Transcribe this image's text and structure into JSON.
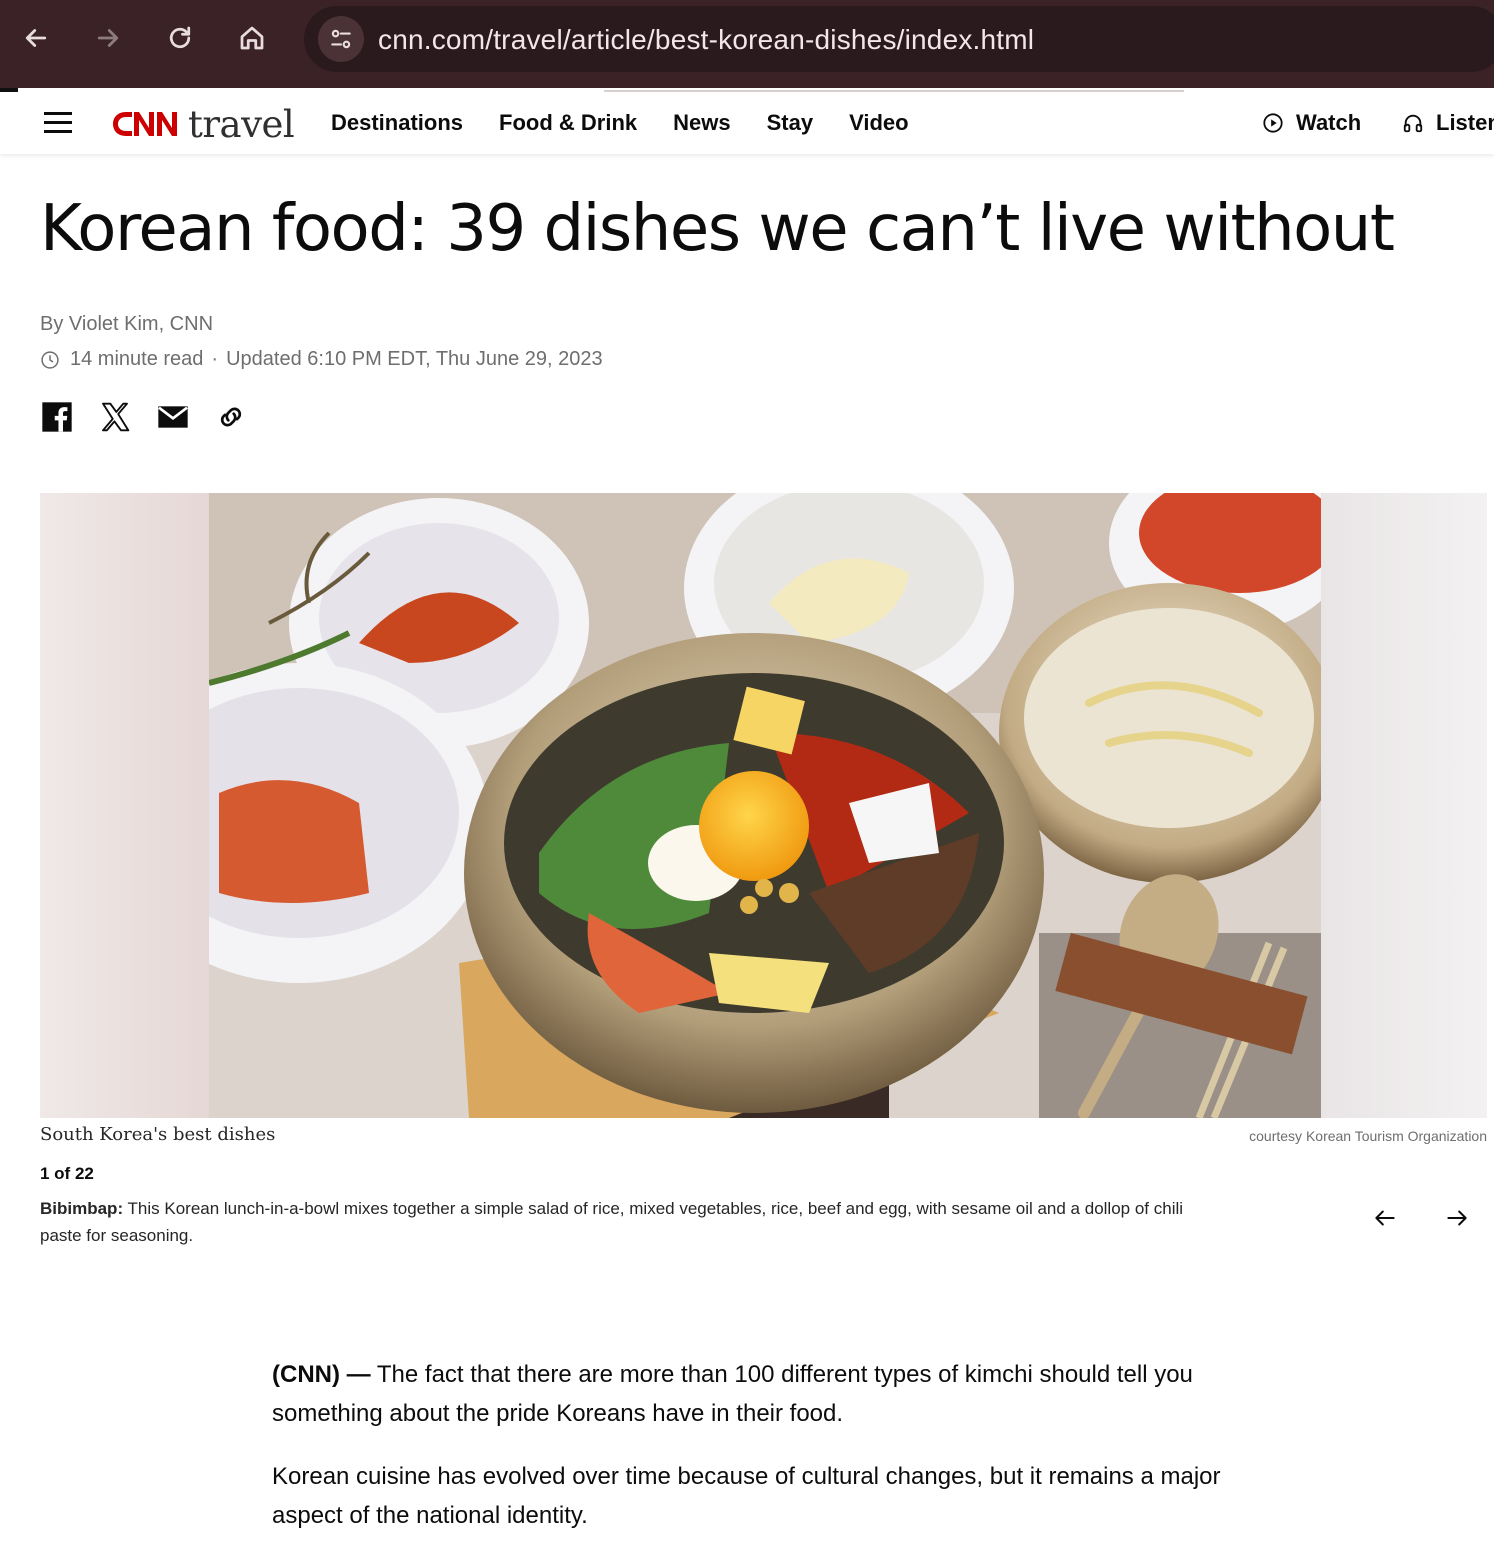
{
  "browser": {
    "url": "cnn.com/travel/article/best-korean-dishes/index.html"
  },
  "header": {
    "logo_brand": "CNN",
    "logo_section": "travel",
    "nav": [
      "Destinations",
      "Food & Drink",
      "News",
      "Stay",
      "Video"
    ],
    "watch_label": "Watch",
    "listen_label": "Listen"
  },
  "article": {
    "headline": "Korean food: 39 dishes we can’t live without",
    "byline": "By Violet Kim, CNN",
    "read_time": "14 minute read",
    "separator": "·",
    "updated": "Updated 6:10 PM EDT, Thu June 29, 2023"
  },
  "share": {
    "icons": [
      "facebook-icon",
      "x-icon",
      "email-icon",
      "link-icon"
    ]
  },
  "gallery": {
    "title": "South Korea's best dishes",
    "credit": "courtesy Korean Tourism Organization",
    "counter": "1 of 22",
    "caption_bold": "Bibimbap:",
    "caption_text": " This Korean lunch-in-a-bowl mixes together a simple salad of rice, mixed vegetables, rice, beef and egg, with sesame oil and a dollop of chili paste for seasoning."
  },
  "body": {
    "p1_lead": "(CNN) —",
    "p1_text": " The fact that there are more than 100 different types of kimchi should tell you something about the pride Koreans have in their food.",
    "p2_text": "Korean cuisine has evolved over time because of cultural changes, but it remains a major aspect of the national identity."
  },
  "colors": {
    "browser_bg": "#3b2227",
    "cnn_red": "#cc0000",
    "text": "#0c0c0c",
    "muted": "#6e6e6e"
  }
}
